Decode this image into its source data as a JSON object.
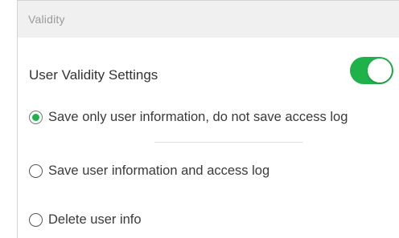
{
  "section": {
    "title": "Validity"
  },
  "user_validity": {
    "label": "User Validity Settings",
    "enabled": true,
    "toggle_color": "#1fb24a"
  },
  "options": [
    {
      "label": "Save only user information, do not save access log",
      "selected": true
    },
    {
      "label": "Save user information and access log",
      "selected": false
    },
    {
      "label": "Delete user info",
      "selected": false
    }
  ]
}
